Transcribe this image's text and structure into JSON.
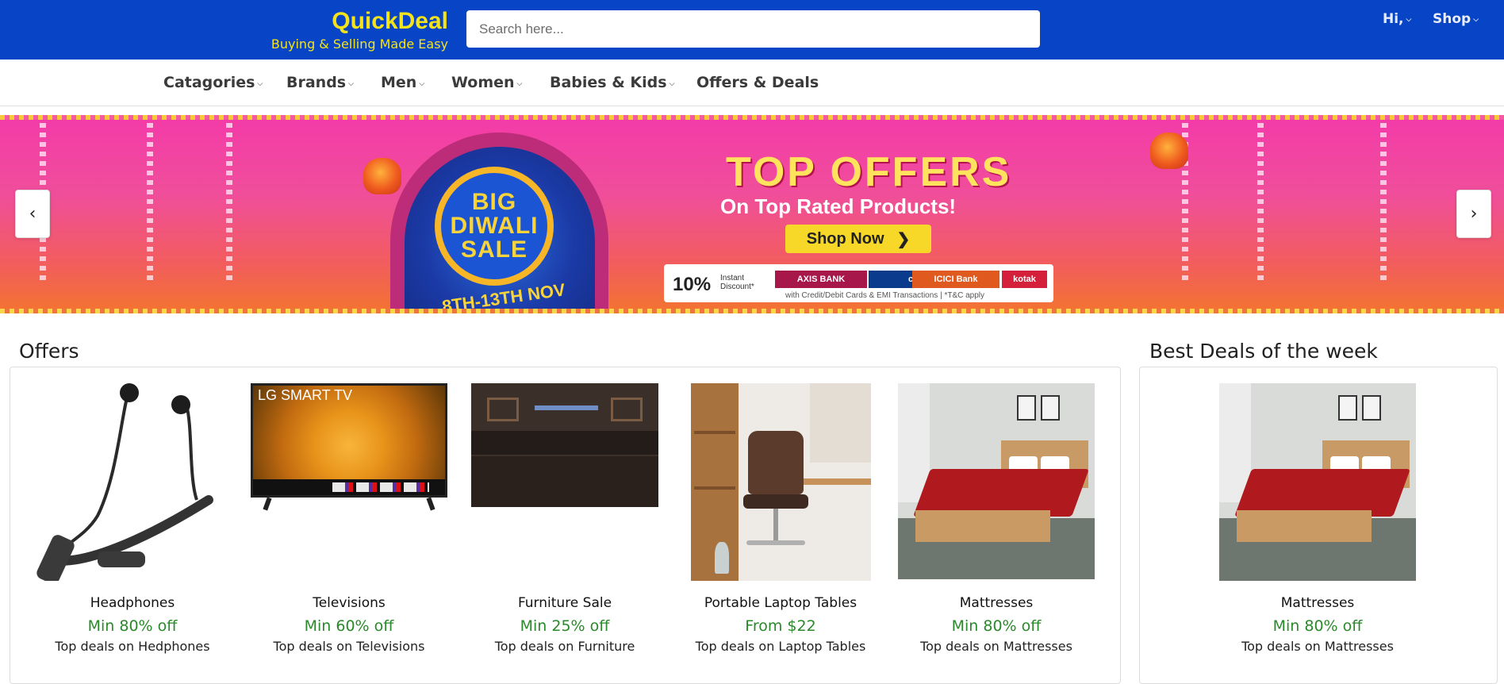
{
  "header": {
    "brand_name": "QuickDeal",
    "brand_tagline": "Buying & Selling Made Easy",
    "search_placeholder": "Search here...",
    "user_menu_label": "Hi,",
    "shop_menu_label": "Shop",
    "colors": {
      "bar": "#0745c6",
      "brand_text": "#f4e21a"
    }
  },
  "nav": {
    "items": [
      {
        "label": "Catagories",
        "has_dropdown": true
      },
      {
        "label": "Brands",
        "has_dropdown": true
      },
      {
        "label": "Men",
        "has_dropdown": true
      },
      {
        "label": "Women",
        "has_dropdown": true
      },
      {
        "label": "Babies & Kids",
        "has_dropdown": true
      },
      {
        "label": "Offers & Deals",
        "has_dropdown": false
      }
    ]
  },
  "banner": {
    "badge_lines": [
      "BIG",
      "DIWALI",
      "SALE"
    ],
    "dates": "8TH-13TH NOV",
    "title": "TOP OFFERS",
    "subtitle": "On Top Rated Products!",
    "cta_label": "Shop Now",
    "discount_percent": "10%",
    "discount_label": "Instant Discount*",
    "banks": [
      "AXIS BANK",
      "citi",
      "ICICI Bank",
      "kotak"
    ],
    "fine_print": "with Credit/Debit Cards & EMI Transactions | *T&C apply",
    "prev_icon": "chevron-left-icon",
    "next_icon": "chevron-right-icon"
  },
  "offers": {
    "title": "Offers",
    "items": [
      {
        "name": "Headphones",
        "offer": "Min 80% off",
        "desc": "Top deals on Hedphones",
        "image": "neckband-headphones"
      },
      {
        "name": "Televisions",
        "offer": "Min 60% off",
        "desc": "Top deals on Televisions",
        "image": "lg-smart-tv",
        "image_text": "LG SMART TV"
      },
      {
        "name": "Furniture Sale",
        "offer": "Min 25% off",
        "desc": "Top deals on Furniture",
        "image": "dark-wood-bed"
      },
      {
        "name": "Portable Laptop Tables",
        "offer": "From $22",
        "desc": "Top deals on Laptop Tables",
        "image": "office-chair"
      },
      {
        "name": "Mattresses",
        "offer": "Min 80% off",
        "desc": "Top deals on Mattresses",
        "image": "red-mattress-bed"
      }
    ]
  },
  "best_deals": {
    "title": "Best Deals of the week",
    "items": [
      {
        "name": "Mattresses",
        "offer": "Min 80% off",
        "desc": "Top deals on Mattresses",
        "image": "red-mattress-bed"
      }
    ]
  },
  "colors": {
    "offer_green": "#2a8a2a"
  }
}
